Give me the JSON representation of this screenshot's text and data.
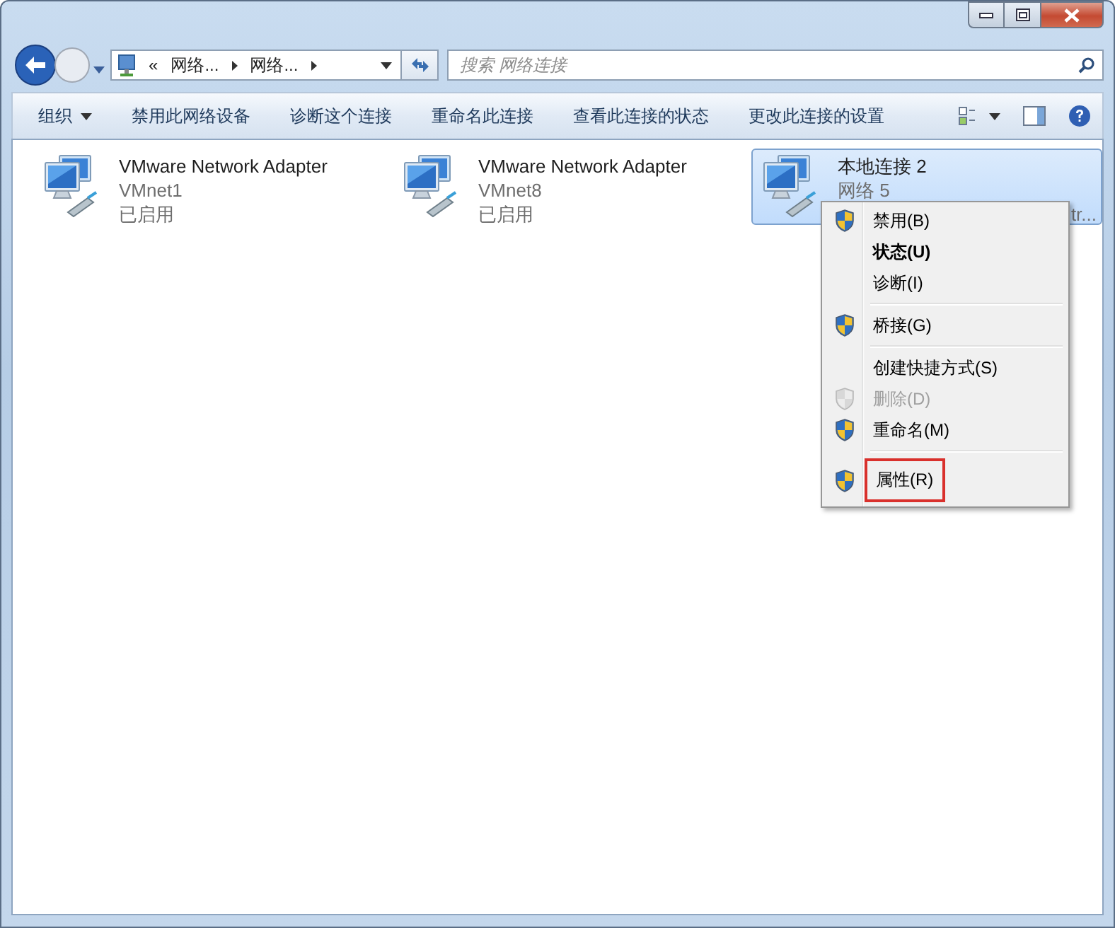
{
  "window": {
    "caption_buttons": [
      {
        "kind": "minimize"
      },
      {
        "kind": "maximize"
      },
      {
        "kind": "close"
      }
    ]
  },
  "address_bar": {
    "crumbs": [
      "«",
      "网络...",
      "网络..."
    ],
    "search_placeholder": "搜索 网络连接"
  },
  "toolbar": {
    "items": [
      {
        "label": "组织",
        "dropdown": true
      },
      {
        "label": "禁用此网络设备",
        "dropdown": false
      },
      {
        "label": "诊断这个连接",
        "dropdown": false
      },
      {
        "label": "重命名此连接",
        "dropdown": false
      },
      {
        "label": "查看此连接的状态",
        "dropdown": false
      },
      {
        "label": "更改此连接的设置",
        "dropdown": false
      }
    ]
  },
  "adapters": [
    {
      "name": "VMware Network Adapter",
      "line2": "VMnet1",
      "line3": "已启用",
      "selected": false
    },
    {
      "name": "VMware Network Adapter",
      "line2": "VMnet8",
      "line3": "已启用",
      "selected": false
    },
    {
      "name": "本地连接 2",
      "line2": "网络  5",
      "line3": "tr...",
      "selected": true
    }
  ],
  "context_menu": {
    "items": [
      {
        "kind": "item",
        "label": "禁用(B)",
        "shield": true,
        "default": false,
        "disabled": false,
        "highlighted": false
      },
      {
        "kind": "item",
        "label": "状态(U)",
        "shield": false,
        "default": true,
        "disabled": false,
        "highlighted": false
      },
      {
        "kind": "item",
        "label": "诊断(I)",
        "shield": false,
        "default": false,
        "disabled": false,
        "highlighted": false
      },
      {
        "kind": "separator"
      },
      {
        "kind": "item",
        "label": "桥接(G)",
        "shield": true,
        "default": false,
        "disabled": false,
        "highlighted": false
      },
      {
        "kind": "separator"
      },
      {
        "kind": "item",
        "label": "创建快捷方式(S)",
        "shield": false,
        "default": false,
        "disabled": false,
        "highlighted": false
      },
      {
        "kind": "item",
        "label": "删除(D)",
        "shield": true,
        "default": false,
        "disabled": true,
        "highlighted": false
      },
      {
        "kind": "item",
        "label": "重命名(M)",
        "shield": true,
        "default": false,
        "disabled": false,
        "highlighted": false
      },
      {
        "kind": "separator"
      },
      {
        "kind": "item",
        "label": "属性(R)",
        "shield": true,
        "default": false,
        "disabled": false,
        "highlighted": true
      }
    ]
  }
}
